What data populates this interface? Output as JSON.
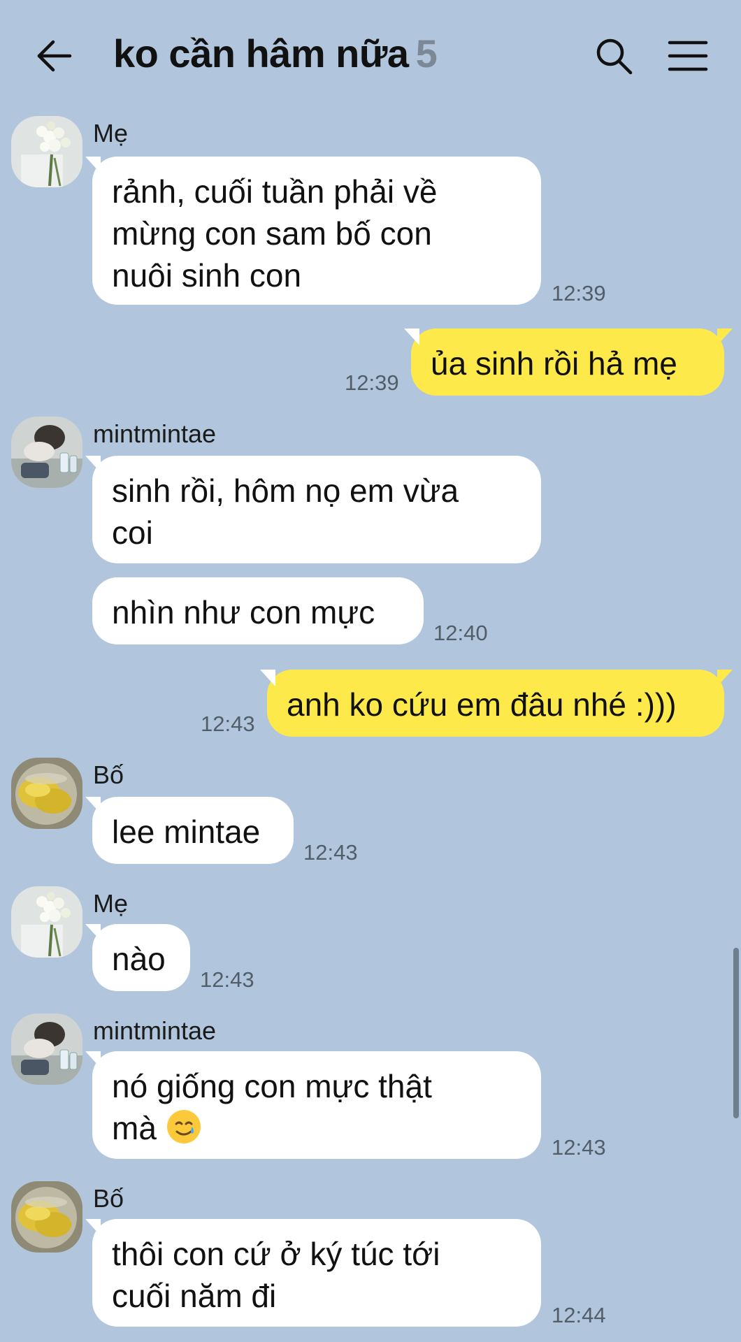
{
  "header": {
    "title": "ko cần hâm nữa",
    "member_count": "5",
    "icons": [
      "back-arrow-icon",
      "search-icon",
      "menu-icon"
    ]
  },
  "messages": [
    {
      "sender": "Mẹ",
      "text": "rảnh, cuối tuần phải về\nmừng con sam bố con\nnuôi sinh con",
      "time": "12:39",
      "outgoing": false
    },
    {
      "sender": "",
      "text": "ủa sinh rồi hả mẹ",
      "time": "12:39",
      "outgoing": true
    },
    {
      "sender": "mintmintae",
      "text": "sinh rồi, hôm nọ em vừa\ncoi",
      "time": "",
      "outgoing": false
    },
    {
      "sender": "",
      "text": "nhìn như con mực",
      "time": "12:40",
      "outgoing": false
    },
    {
      "sender": "",
      "text": "anh ko cứu em đâu nhé :)))",
      "time": "12:43",
      "outgoing": true
    },
    {
      "sender": "Bố",
      "text": "lee mintae",
      "time": "12:43",
      "outgoing": false
    },
    {
      "sender": "Mẹ",
      "text": "nào",
      "time": "12:43",
      "outgoing": false
    },
    {
      "sender": "mintmintae",
      "text": "nó giống con mực thật\nmà",
      "time": "12:43",
      "outgoing": false,
      "emoji": "smiling-face-with-tear-icon"
    },
    {
      "sender": "Bố",
      "text": "thôi con cứ ở ký túc tới\ncuối năm đi",
      "time": "12:44",
      "outgoing": false
    }
  ],
  "colors": {
    "background": "#b1c6dc",
    "outgoing_bubble": "#fee94a",
    "incoming_bubble": "#ffffff",
    "member_count": "#7c8896",
    "timestamp": "#525d6a"
  }
}
